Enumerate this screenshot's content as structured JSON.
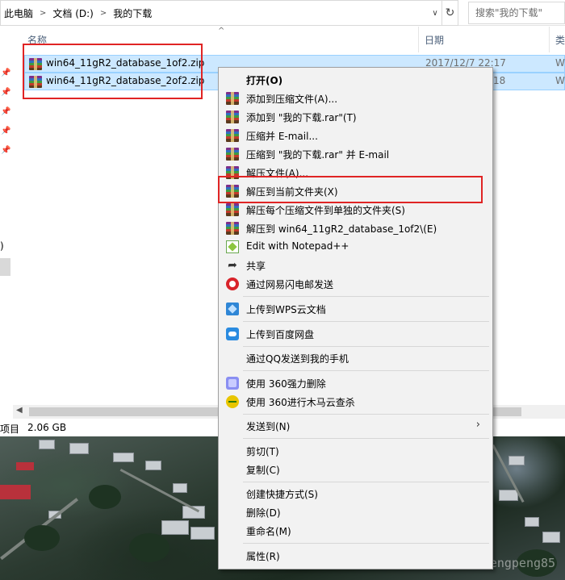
{
  "address_bar": {
    "breadcrumbs": [
      "此电脑",
      "文档 (D:)",
      "我的下载"
    ],
    "search_placeholder": "搜索\"我的下载\""
  },
  "columns": {
    "name": "名称",
    "date": "日期",
    "type_partial": "类"
  },
  "files": [
    {
      "name": "win64_11gR2_database_1of2.zip",
      "date": "2017/12/7 22:17",
      "type_partial": "W"
    },
    {
      "name": "win64_11gR2_database_2of2.zip",
      "date": "18",
      "type_partial": "W"
    }
  ],
  "nav": {
    "fragment": ")"
  },
  "status": {
    "label": "项目",
    "size": "2.06 GB"
  },
  "context_menu": {
    "items": [
      {
        "label": "打开(O)",
        "icon": "none"
      },
      {
        "label": "添加到压缩文件(A)...",
        "icon": "winrar-icon"
      },
      {
        "label": "添加到 \"我的下载.rar\"(T)",
        "icon": "winrar-icon"
      },
      {
        "label": "压缩并 E-mail...",
        "icon": "winrar-icon"
      },
      {
        "label": "压缩到 \"我的下载.rar\" 并 E-mail",
        "icon": "winrar-icon"
      },
      {
        "label": "解压文件(A)...",
        "icon": "winrar-icon"
      },
      {
        "label": "解压到当前文件夹(X)",
        "icon": "winrar-icon"
      },
      {
        "label": "解压每个压缩文件到单独的文件夹(S)",
        "icon": "winrar-icon"
      },
      {
        "label": "解压到 win64_11gR2_database_1of2\\(E)",
        "icon": "winrar-icon"
      },
      {
        "label": "Edit with Notepad++",
        "icon": "notepad-plus-plus-icon"
      },
      {
        "label": "共享",
        "icon": "share-icon"
      },
      {
        "label": "通过网易闪电邮发送",
        "icon": "netease-mail-icon"
      },
      {
        "label": "上传到WPS云文档",
        "icon": "wps-cloud-icon"
      },
      {
        "label": "上传到百度网盘",
        "icon": "baidu-netdisk-icon"
      },
      {
        "label": "通过QQ发送到我的手机",
        "icon": "none"
      },
      {
        "label": "使用 360强力删除",
        "icon": "360-delete-icon"
      },
      {
        "label": "使用 360进行木马云查杀",
        "icon": "360-scan-icon"
      },
      {
        "label": "发送到(N)",
        "icon": "none"
      },
      {
        "label": "剪切(T)",
        "icon": "none"
      },
      {
        "label": "复制(C)",
        "icon": "none"
      },
      {
        "label": "创建快捷方式(S)",
        "icon": "none"
      },
      {
        "label": "删除(D)",
        "icon": "none"
      },
      {
        "label": "重命名(M)",
        "icon": "none"
      },
      {
        "label": "属性(R)",
        "icon": "none"
      }
    ]
  },
  "watermark": "http://blog.csdn.net/pengpengpeng85",
  "colors": {
    "selection_bg": "#cce8ff",
    "selection_border": "#99d1ff",
    "highlight_box": "#e02424",
    "menu_bg": "#f2f2f2"
  }
}
